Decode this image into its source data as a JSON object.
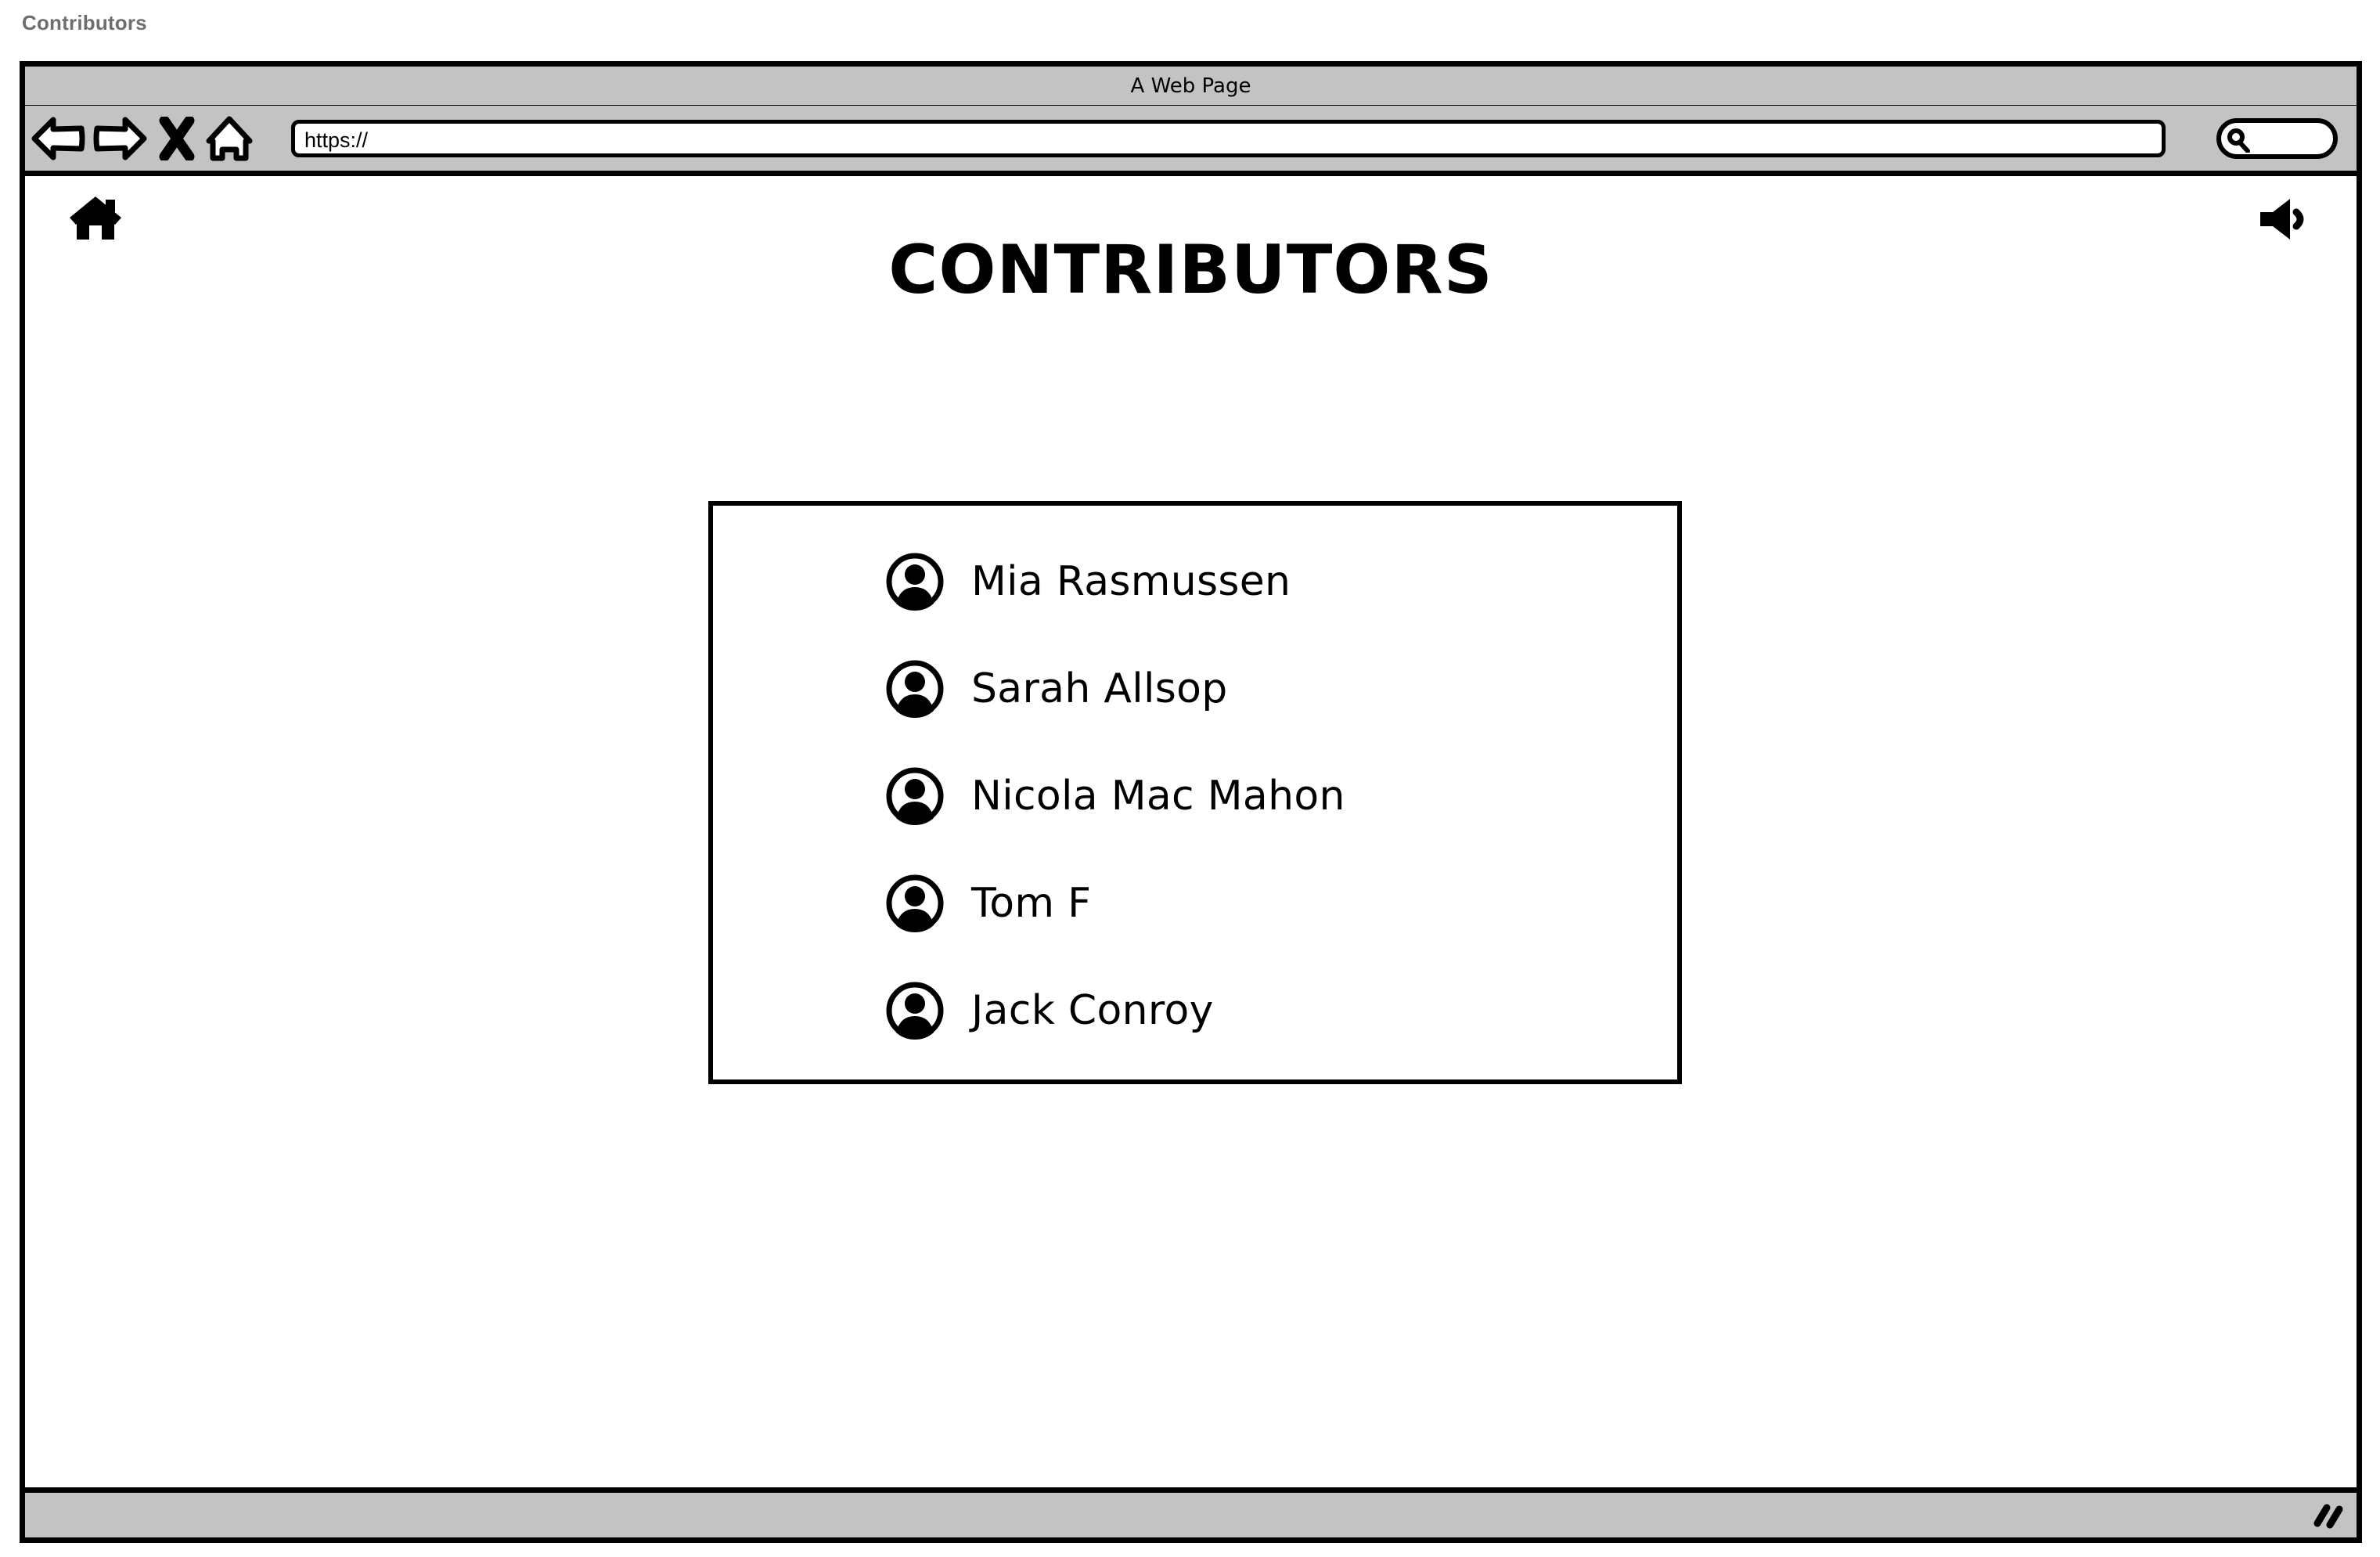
{
  "mockup": {
    "label": "Contributors"
  },
  "browser": {
    "title": "A Web Page",
    "nav": {
      "back_label": "Back",
      "forward_label": "Forward",
      "stop_label": "Stop",
      "home_label": "Home"
    },
    "url": {
      "value": "https://",
      "placeholder": "https://"
    },
    "search": {
      "value": "",
      "placeholder": ""
    },
    "footer": {
      "status": ""
    }
  },
  "page": {
    "home_button_label": "Home",
    "volume_button_label": "Volume",
    "title": "CONTRIBUTORS",
    "contributors": [
      {
        "name": "Mia Rasmussen"
      },
      {
        "name": "Sarah Allsop"
      },
      {
        "name": "Nicola Mac Mahon"
      },
      {
        "name": "Tom F"
      },
      {
        "name": "Jack Conroy"
      }
    ]
  },
  "colors": {
    "chrome_gray": "#c3c3c3",
    "ink": "#000000",
    "label_gray": "#6e6e6e",
    "canvas": "#ffffff"
  }
}
